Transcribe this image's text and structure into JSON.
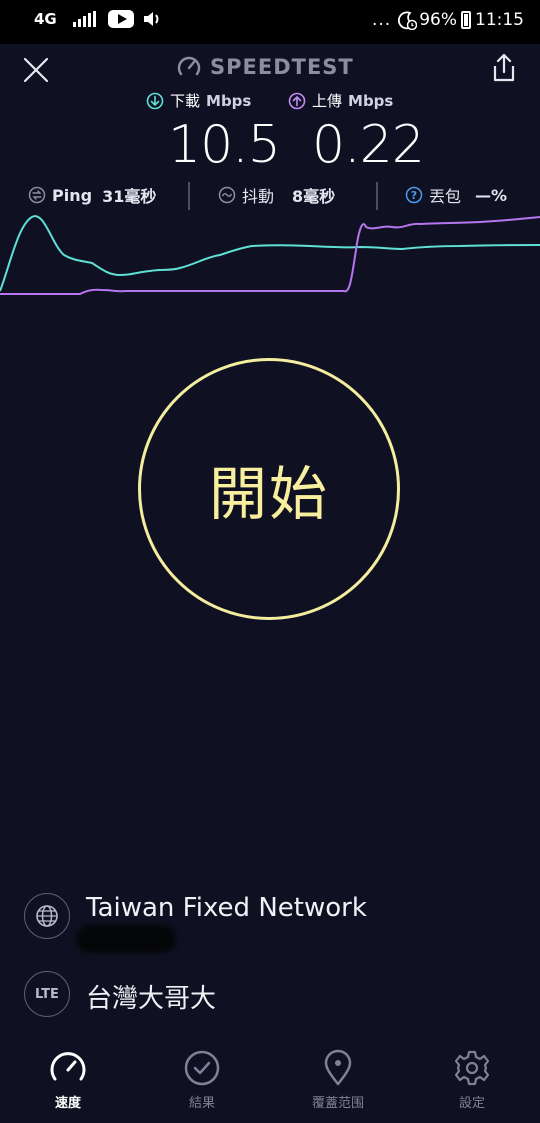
{
  "status_bar": {
    "network": "4G",
    "dots": "...",
    "battery": "96%",
    "time": "11:15"
  },
  "header": {
    "brand": "SPEEDTEST"
  },
  "download": {
    "label": "下載",
    "unit": "Mbps",
    "value": "10.5",
    "color": "#5fe0d6"
  },
  "upload": {
    "label": "上傳",
    "unit": "Mbps",
    "value": "0.22",
    "color": "#c58cf5"
  },
  "stats": {
    "ping_label": "Ping",
    "ping_value": "31毫秒",
    "jitter_label": "抖動",
    "jitter_value": "8毫秒",
    "loss_label": "丟包",
    "loss_value": "—%"
  },
  "start_button": {
    "label": "開始",
    "color": "#f4ec9e"
  },
  "provider": {
    "name": "Taiwan Fixed Network"
  },
  "carrier": {
    "badge": "LTE",
    "name": "台灣大哥大"
  },
  "nav": {
    "items": [
      {
        "label": "速度",
        "icon": "speedometer-icon",
        "active": true
      },
      {
        "label": "結果",
        "icon": "check-circle-icon",
        "active": false
      },
      {
        "label": "覆蓋范围",
        "icon": "map-pin-icon",
        "active": false
      },
      {
        "label": "設定",
        "icon": "gear-icon",
        "active": false
      }
    ]
  }
}
